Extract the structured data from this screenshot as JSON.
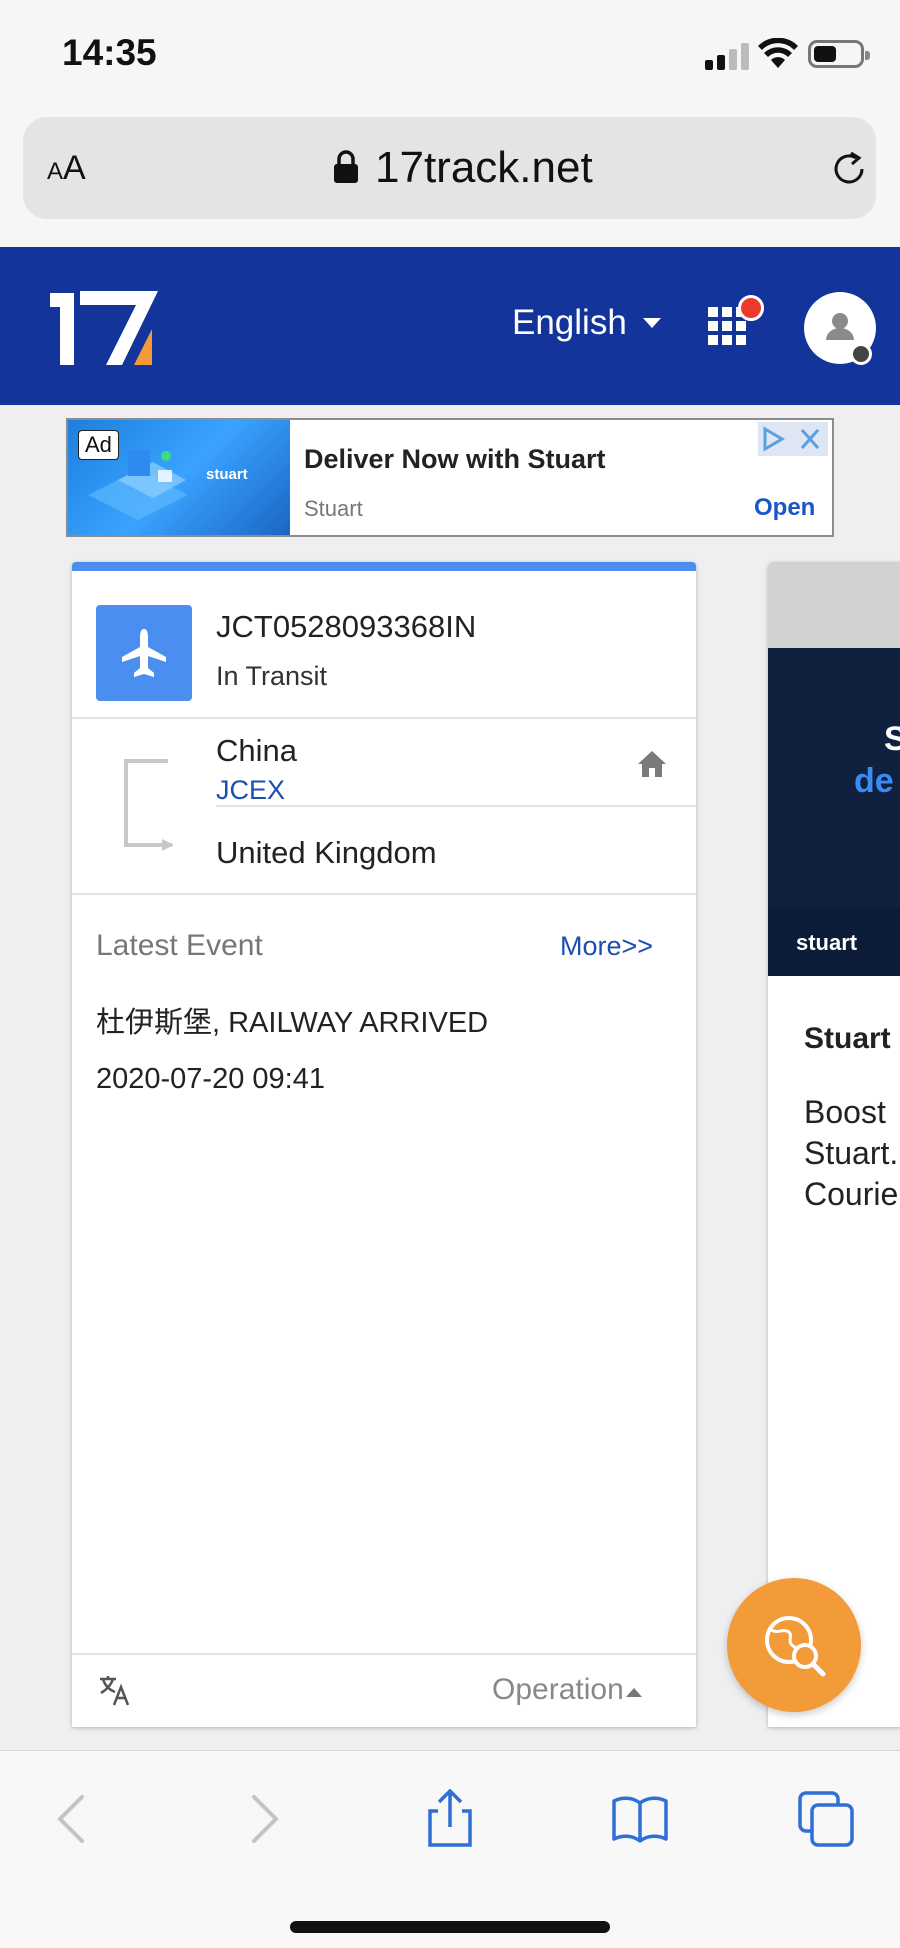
{
  "status_bar": {
    "time": "14:35"
  },
  "browser": {
    "text_size_label": "AA",
    "url": "17track.net"
  },
  "header": {
    "language": "English",
    "brand_color": "#12349b"
  },
  "ad": {
    "label": "Ad",
    "title": "Deliver Now with Stuart",
    "advertiser": "Stuart",
    "cta": "Open",
    "image_brand": "stuart"
  },
  "tracking": {
    "number": "JCT0528093368IN",
    "status": "In Transit",
    "origin": "China",
    "carrier": "JCEX",
    "destination": "United Kingdom",
    "latest_event_label": "Latest Event",
    "more_link": "More>>",
    "event_description": "杜伊斯堡, RAILWAY ARRIVED",
    "event_time": "2020-07-20 09:41",
    "operation_label": "Operation",
    "accent_color": "#4a8ff0"
  },
  "side_ad": {
    "headline_part1": "S",
    "headline_part2": "de",
    "brand": "stuart",
    "title": "Stuart",
    "body_line1": "Boost",
    "body_line2": "Stuart.",
    "body_line3": "Courie"
  },
  "fab": {
    "color": "#f29b38",
    "icon": "search-globe-icon"
  }
}
